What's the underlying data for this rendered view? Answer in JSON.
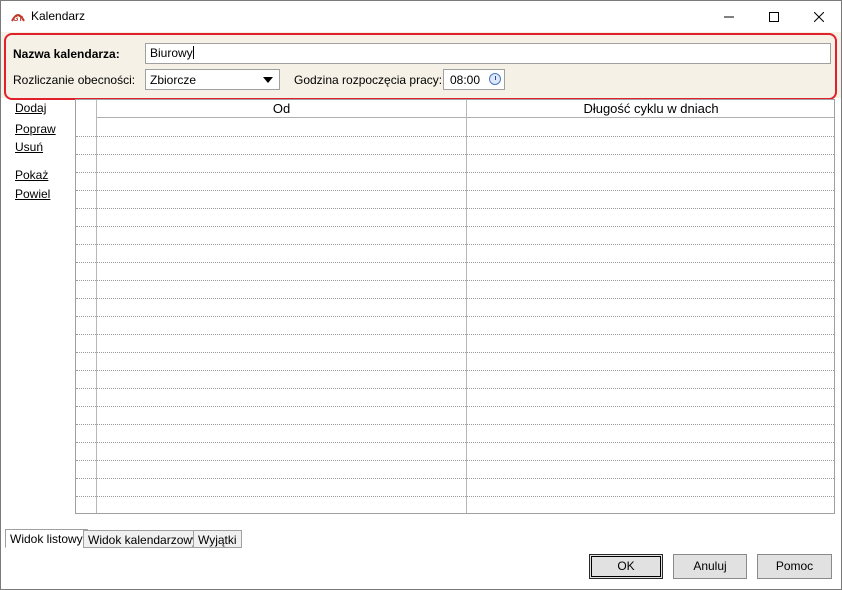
{
  "window": {
    "title": "Kalendarz"
  },
  "header": {
    "name_label": "Nazwa kalendarza:",
    "name_value": "Biurowy",
    "attendance_label": "Rozliczanie obecności:",
    "attendance_value": "Zbiorcze",
    "start_time_label": "Godzina rozpoczęcia pracy:",
    "start_time_value": "08:00"
  },
  "actions": [
    "Dodaj",
    "Popraw",
    "Usuń",
    "Pokaż",
    "Powiel"
  ],
  "table": {
    "columns": [
      "Od",
      "Długość cyklu w dniach"
    ],
    "rows": []
  },
  "tabs": [
    "Widok listowy",
    "Widok kalendarzowy",
    "Wyjątki"
  ],
  "active_tab": "Widok listowy",
  "buttons": {
    "ok": "OK",
    "cancel": "Anuluj",
    "help": "Pomoc"
  },
  "colors": {
    "header_bg": "#f6f1e7",
    "highlight": "#e0202a",
    "app_icon": "#c0392b"
  }
}
